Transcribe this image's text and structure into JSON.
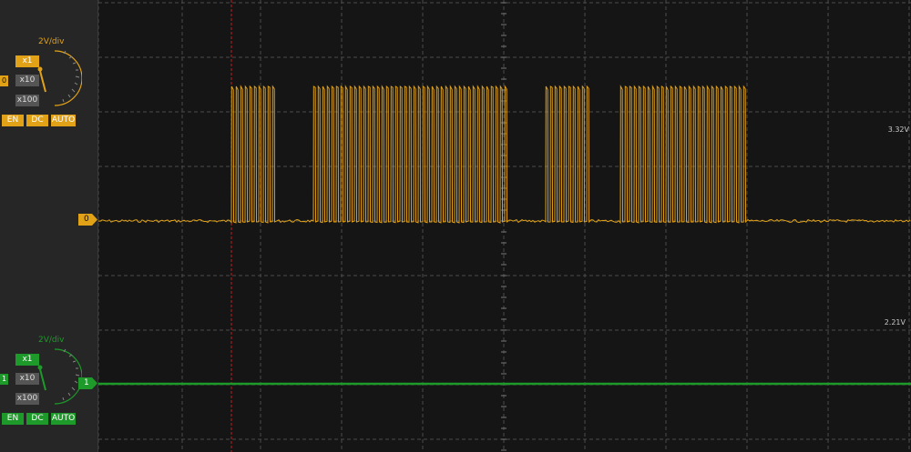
{
  "colors": {
    "ch1": "#e2a218",
    "ch2": "#1d9a2a",
    "grid": "#4a4a4a"
  },
  "channels": [
    {
      "id": "ch1",
      "volts_per_div": "2V/div",
      "tag": "0",
      "multipliers": [
        "x1",
        "x10",
        "x100"
      ],
      "selected_multiplier": "x1",
      "buttons": [
        "EN",
        "DC",
        "AUTO"
      ],
      "marker": "0",
      "level_readout": "3.32V"
    },
    {
      "id": "ch2",
      "volts_per_div": "2V/div",
      "tag": "1",
      "multipliers": [
        "x1",
        "x10",
        "x100"
      ],
      "selected_multiplier": "x1",
      "buttons": [
        "EN",
        "DC",
        "AUTO"
      ],
      "marker": "1",
      "level_readout": "2.21V"
    }
  ]
}
